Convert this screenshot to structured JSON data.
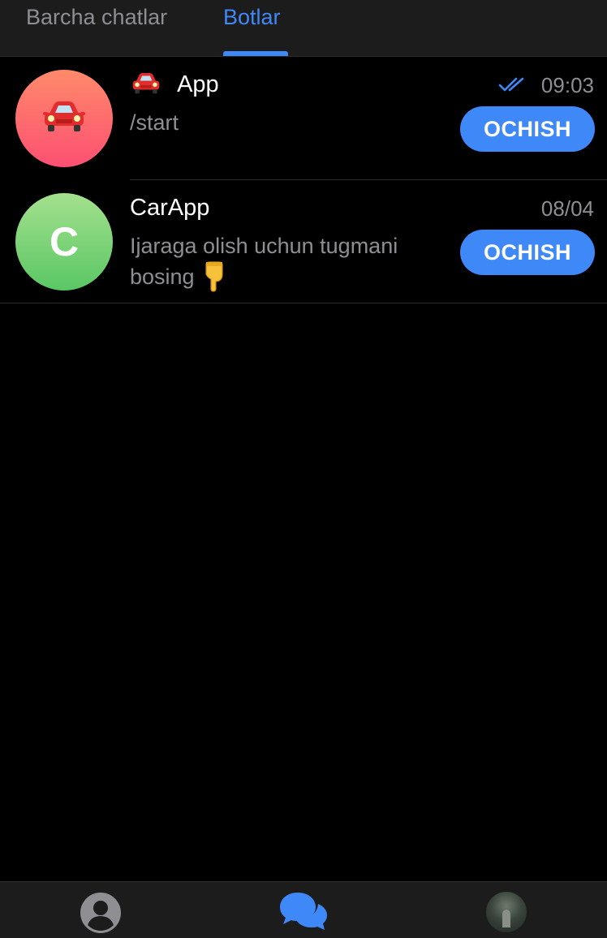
{
  "tabs": [
    {
      "label": "Barcha chatlar",
      "active": false
    },
    {
      "label": "Botlar",
      "active": true
    }
  ],
  "chats": [
    {
      "title": "App",
      "title_icon": "car-emoji-icon",
      "preview": "/start",
      "time": "09:03",
      "read_status": "double-check-icon",
      "button": "OCHISH",
      "avatar_icon": "car-emoji-icon",
      "avatar_color": "#fd5072"
    },
    {
      "title": "CarApp",
      "preview": "Ijaraga olish uchun tugmani bosing",
      "preview_icon": "pointing-down-hand-icon",
      "time": "08/04",
      "button": "OCHISH",
      "avatar_letter": "C",
      "avatar_color": "#5ac764"
    }
  ],
  "tabbar": {
    "items": [
      "contacts-icon",
      "chats-icon",
      "profile-avatar"
    ],
    "active": "chats-icon"
  },
  "colors": {
    "accent": "#3e88f7",
    "background": "#000000",
    "bar": "#1c1c1d",
    "secondary_text": "#8e8e93"
  }
}
